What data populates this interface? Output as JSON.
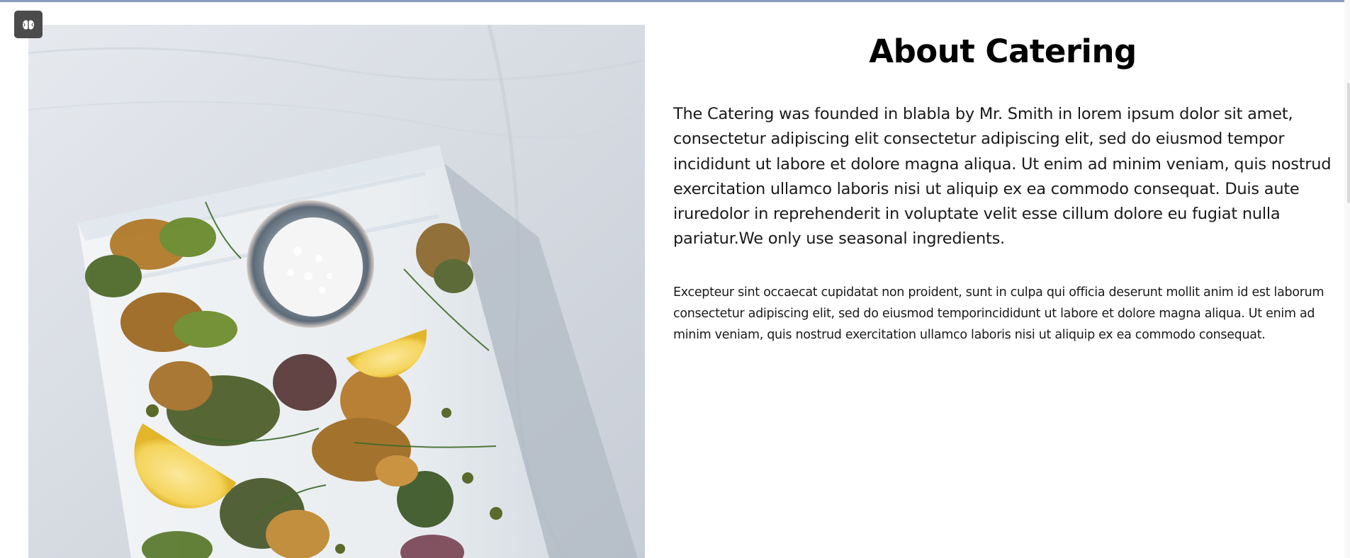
{
  "extension": {
    "icon": "brain-icon"
  },
  "about": {
    "image_alt": "Fried vegetable tempura with lemon slices and a bowl of salt on a white board",
    "title": "About Catering",
    "lead": "The Catering was founded in blabla by Mr. Smith in lorem ipsum dolor sit amet, consectetur adipiscing elit consectetur adipiscing elit, sed do eiusmod tempor incididunt ut labore et dolore magna aliqua. Ut enim ad minim veniam, quis nostrud exercitation ullamco laboris nisi ut aliquip ex ea commodo consequat. Duis aute iruredolor in reprehenderit in voluptate velit esse cillum dolore eu fugiat nulla pariatur.We only use seasonal ingredients.",
    "body": "Excepteur sint occaecat cupidatat non proident, sunt in culpa qui officia deserunt mollit anim id est laborum consectetur adipiscing elit, sed do eiusmod temporincididunt ut labore et dolore magna aliqua. Ut enim ad minim veniam, quis nostrud exercitation ullamco laboris nisi ut aliquip ex ea commodo consequat."
  },
  "colors": {
    "top_border": "#8a9bb8",
    "badge": "#4b4b4b",
    "linen": "#dfe3e8",
    "board": "#eef1f3"
  }
}
